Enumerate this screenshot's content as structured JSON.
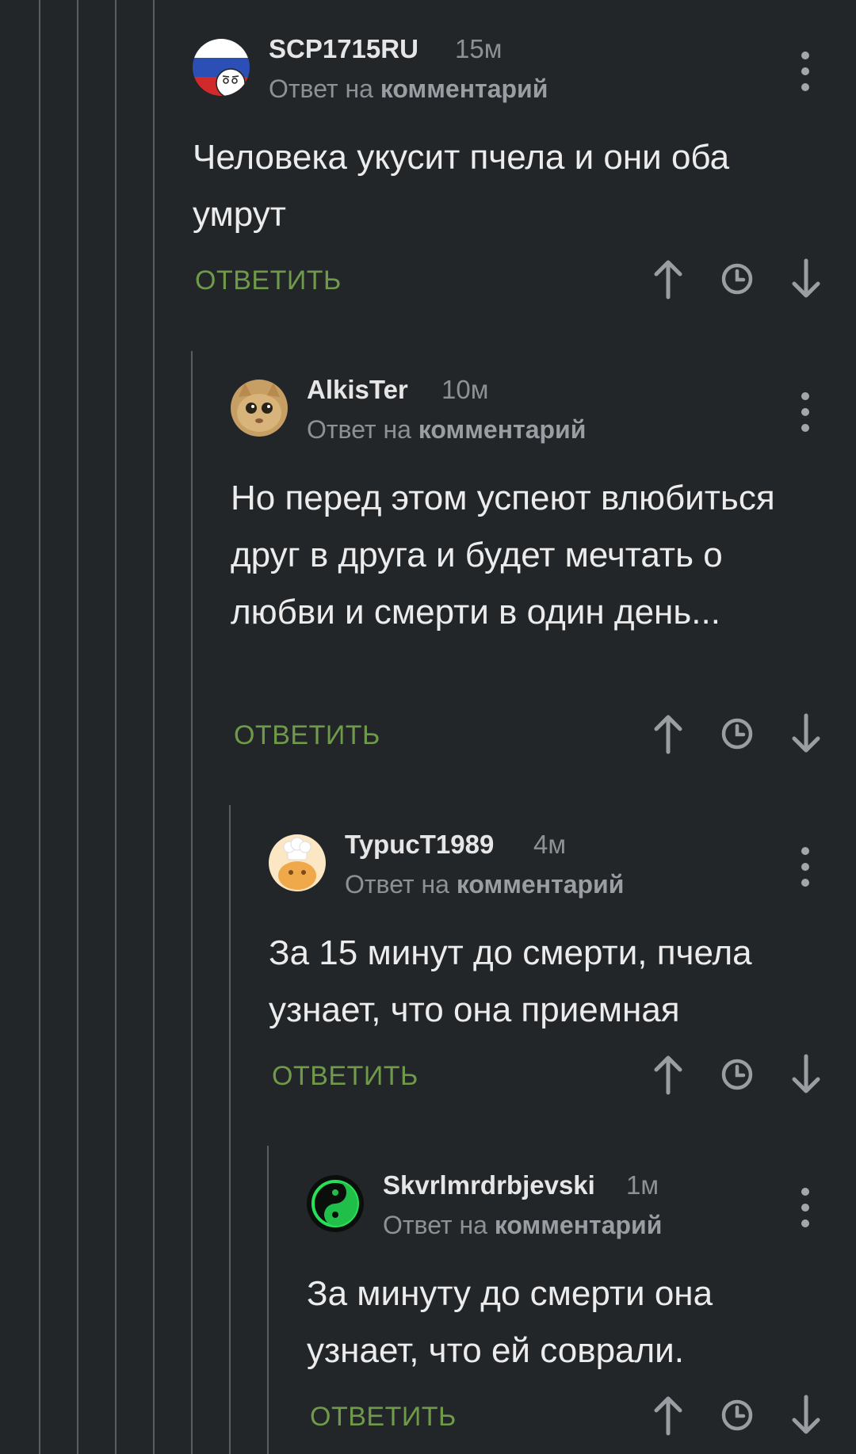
{
  "comments": [
    {
      "author": "SCP1715RU",
      "time": "15м",
      "reply_prefix": "Ответ на",
      "reply_target": "комментарий",
      "text": "Человека укусит пчела и они оба умрут",
      "reply_label": "ОТВЕТИТЬ"
    },
    {
      "author": "AlkisTer",
      "time": "10м",
      "reply_prefix": "Ответ на",
      "reply_target": "комментарий",
      "text": "Но перед этом успеют влюбиться друг в друга и будет мечтать о любви и смерти в один день...",
      "reply_label": "ОТВЕТИТЬ"
    },
    {
      "author": "TypucT1989",
      "time": "4м",
      "reply_prefix": "Ответ на",
      "reply_target": "комментарий",
      "text": "За 15 минут до смерти, пчела узнает, что она приемная",
      "reply_label": "ОТВЕТИТЬ"
    },
    {
      "author": "Skvrlmrdrbjevski",
      "time": "1м",
      "reply_prefix": "Ответ на",
      "reply_target": "комментарий",
      "text": "За минуту до смерти она узнает, что ей соврали.",
      "reply_label": "ОТВЕТИТЬ"
    }
  ],
  "icons": {
    "upvote": "arrow-up-icon",
    "save": "clock-icon",
    "downvote": "arrow-down-icon",
    "more": "more-vertical-icon"
  },
  "colors": {
    "background": "#232629",
    "accent_green": "#6f9a4a",
    "text": "#ececec",
    "muted": "#8d9196"
  }
}
